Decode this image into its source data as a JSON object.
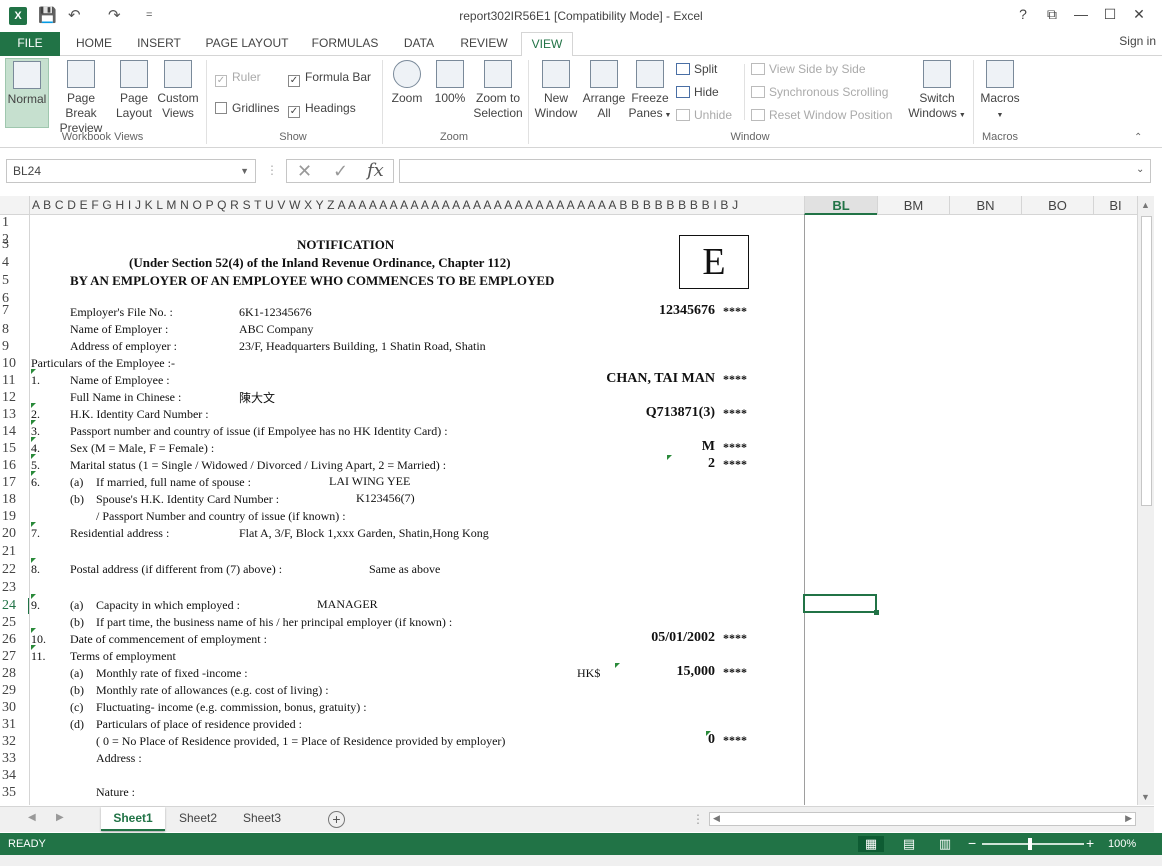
{
  "window": {
    "title": "report302IR56E1  [Compatibility Mode] - Excel",
    "app_icon": "X",
    "controls": {
      "help": "?",
      "restore_ribbon": "⧉",
      "minimize": "—",
      "maximize": "☐",
      "close": "✕"
    }
  },
  "qat": {
    "save": "💾",
    "undo": "↶",
    "redo": "↷",
    "customize": "="
  },
  "tabs": [
    "FILE",
    "HOME",
    "INSERT",
    "PAGE LAYOUT",
    "FORMULAS",
    "DATA",
    "REVIEW",
    "VIEW"
  ],
  "active_tab": "VIEW",
  "signin": "Sign in",
  "ribbon": {
    "workbook_views": {
      "label": "Workbook Views",
      "normal": "Normal",
      "page_break_1": "Page Break",
      "page_break_2": "Preview",
      "page_layout_1": "Page",
      "page_layout_2": "Layout",
      "custom_1": "Custom",
      "custom_2": "Views"
    },
    "show": {
      "label": "Show",
      "ruler": "Ruler",
      "gridlines": "Gridlines",
      "formula_bar": "Formula Bar",
      "headings": "Headings",
      "ruler_checked": true,
      "gridlines_checked": false,
      "formula_bar_checked": true,
      "headings_checked": true
    },
    "zoom": {
      "label": "Zoom",
      "zoom": "Zoom",
      "hundred": "100%",
      "zoom_sel_1": "Zoom to",
      "zoom_sel_2": "Selection"
    },
    "window": {
      "label": "Window",
      "new_1": "New",
      "new_2": "Window",
      "arrange_1": "Arrange",
      "arrange_2": "All",
      "freeze_1": "Freeze",
      "freeze_2": "Panes",
      "split": "Split",
      "hide": "Hide",
      "unhide": "Unhide",
      "side_by_side": "View Side by Side",
      "sync_scroll": "Synchronous Scrolling",
      "reset_pos": "Reset Window Position",
      "switch_1": "Switch",
      "switch_2": "Windows"
    },
    "macros": {
      "label": "Macros",
      "macros": "Macros"
    }
  },
  "formula_bar": {
    "name_box": "BL24",
    "fx": "fx",
    "cancel": "✕",
    "enter": "✓",
    "value": ""
  },
  "columns": {
    "narrow": "A B C D E F G H I  J  K L M N O P  Q R S  T U V W X Y Z A A A A A A A A A A A A A A A A A A A A A A A A A A A B B B B B B B B I  B J",
    "wide": [
      "BL",
      "BM",
      "BN",
      "BO",
      "BI"
    ],
    "selected": "BL"
  },
  "rows": [
    "1",
    "2",
    "3",
    "4",
    "5",
    "6",
    "7",
    "8",
    "9",
    "10",
    "11",
    "12",
    "13",
    "14",
    "15",
    "16",
    "17",
    "18",
    "19",
    "20",
    "21",
    "22",
    "23",
    "24",
    "25",
    "26",
    "27",
    "28",
    "29",
    "30",
    "31",
    "32",
    "33",
    "34",
    "35"
  ],
  "selected_row": "24",
  "form": {
    "title1": "NOTIFICATION",
    "title2": "(Under Section 52(4) of the Inland Revenue Ordinance, Chapter 112)",
    "title3": "BY AN EMPLOYER OF AN EMPLOYEE WHO COMMENCES TO BE EMPLOYED",
    "form_letter": "E",
    "stars": "****",
    "r7_label": "Employer's File No. :",
    "r7_value": "6K1-12345676",
    "r7_big": "12345676",
    "r8_label": "Name of Employer :",
    "r8_value": "ABC Company",
    "r9_label": "Address of employer :",
    "r9_value": "23/F, Headquarters Building, 1 Shatin Road, Shatin",
    "r10_label": "Particulars of the Employee :-",
    "r11_num": "1.",
    "r11_label": "Name of Employee :",
    "r11_big": "CHAN, TAI MAN",
    "r12_label": "Full Name in Chinese :",
    "r12_value": "陳大文",
    "r13_num": "2.",
    "r13_label": "H.K. Identity Card Number :",
    "r13_big": "Q713871(3)",
    "r14_num": "3.",
    "r14_label": "Passport number and country of issue (if Empolyee has no HK Identity Card) :",
    "r15_num": "4.",
    "r15_label": "Sex (M = Male, F = Female) :",
    "r15_big": "M",
    "r16_num": "5.",
    "r16_label": "Marital status (1 = Single / Widowed / Divorced / Living Apart, 2 = Married) :",
    "r16_big": "2",
    "r17_num": "6.",
    "r17_sub": "(a)",
    "r17_label": "If married, full name of spouse :",
    "r17_value": "LAI WING YEE",
    "r18_sub": "(b)",
    "r18_label": "Spouse's H.K. Identity Card Number :",
    "r18_value": "K123456(7)",
    "r19_label": "/ Passport Number and country of issue (if known) :",
    "r20_num": "7.",
    "r20_label": "Residential address :",
    "r20_value": "Flat A, 3/F, Block 1,xxx Garden, Shatin,Hong Kong",
    "r22_num": "8.",
    "r22_label": "Postal address (if different from (7) above) :",
    "r22_value": "Same as above",
    "r24_num": "9.",
    "r24_sub": "(a)",
    "r24_label": "Capacity in which employed :",
    "r24_value": "MANAGER",
    "r25_sub": "(b)",
    "r25_label": "If part time, the business name of his / her principal employer (if known) :",
    "r26_num": "10.",
    "r26_label": "Date of commencement of employment :",
    "r26_big": "05/01/2002",
    "r27_num": "11.",
    "r27_label": "Terms of employment",
    "r28_sub": "(a)",
    "r28_label": "Monthly rate of fixed -income :",
    "r28_cur": "HK$",
    "r28_big": "15,000",
    "r29_sub": "(b)",
    "r29_label": "Monthly rate of allowances (e.g. cost of living) :",
    "r30_sub": "(c)",
    "r30_label": "Fluctuating- income (e.g. commission, bonus, gratuity) :",
    "r31_sub": "(d)",
    "r31_label": "Particulars of place of residence provided :",
    "r32_label": "( 0 = No Place of Residence provided, 1 = Place of Residence provided by employer)",
    "r32_big": "0",
    "r33_label": "Address :",
    "r35_label": "Nature :"
  },
  "sheets": [
    "Sheet1",
    "Sheet2",
    "Sheet3"
  ],
  "active_sheet": "Sheet1",
  "add_sheet": "+",
  "status": {
    "ready": "READY",
    "zoom": "100%",
    "minus": "−",
    "plus": "+"
  },
  "colors": {
    "accent": "#217346"
  }
}
